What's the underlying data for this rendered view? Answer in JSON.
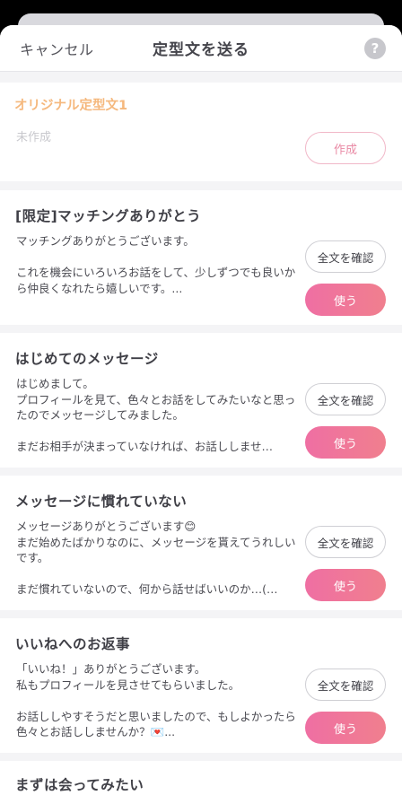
{
  "header": {
    "cancel_label": "キャンセル",
    "title": "定型文を送る",
    "help_label": "?"
  },
  "original": {
    "title": "オリジナル定型文1",
    "empty_text": "未作成",
    "create_label": "作成"
  },
  "templates": [
    {
      "title": "[限定]マッチングありがとう",
      "body": "マッチングありがとうございます。\n\nこれを機会にいろいろお話をして、少しずつでも良いから仲良くなれたら嬉しいです。...",
      "confirm_label": "全文を確認",
      "use_label": "使う"
    },
    {
      "title": "はじめてのメッセージ",
      "body": "はじめまして。\nプロフィールを見て、色々とお話をしてみたいなと思ったのでメッセージしてみました。\n\nまだお相手が決まっていなければ、お話ししませ…",
      "confirm_label": "全文を確認",
      "use_label": "使う"
    },
    {
      "title": "メッセージに慣れていない",
      "body": "メッセージありがとうございます😊\nまだ始めたばかりなのに、メッセージを貰えてうれしいです。\n\nまだ慣れていないので、何から話せばいいのか…(…",
      "confirm_label": "全文を確認",
      "use_label": "使う"
    },
    {
      "title": "いいねへのお返事",
      "body": "「いいね！」ありがとうございます。\n私もプロフィールを見させてもらいました。\n\nお話ししやすそうだと思いましたので、もしよかったら色々とお話ししませんか？💌...",
      "confirm_label": "全文を確認",
      "use_label": "使う"
    }
  ],
  "last_card": {
    "title": "まずは会ってみたい"
  },
  "colors": {
    "accent_pink": "#ef6fa3",
    "accent_orange": "#f5b87d",
    "background": "#f4f4f6"
  }
}
